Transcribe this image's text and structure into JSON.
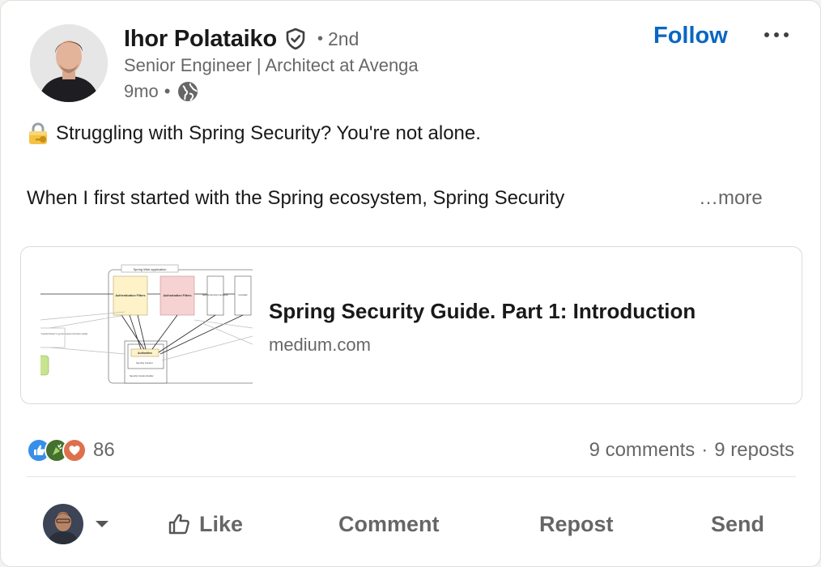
{
  "post": {
    "author": {
      "name": "Ihor Polataiko",
      "degree": "2nd",
      "degree_separator": "•",
      "headline": "Senior Engineer | Architect at Avenga",
      "time": "9mo",
      "time_separator": "•",
      "follow_label": "Follow",
      "more_label": "•••"
    },
    "text": {
      "line1": "Struggling with Spring Security? You're not alone.",
      "line2": "When I first started with the Spring ecosystem, Spring Security",
      "see_more": "…more"
    },
    "article": {
      "title": "Spring Security Guide. Part 1: Introduction",
      "source": "medium.com",
      "thumbnail_text": {
        "app_box": "Spring Web application",
        "auth_filters": "Authentication Filters",
        "authz_filters": "Authorization Filters",
        "method_security": "Method Security Interceptor",
        "controller": "Controller",
        "authorities": "Authorities",
        "security_context": "Security Context",
        "context_holder": "Security Context Holder",
        "note": "\"unauthenticated\" to get the request information details"
      }
    },
    "social": {
      "reactions_count": "86",
      "comments": "9 comments",
      "separator": "·",
      "reposts": "9 reposts"
    },
    "actions": {
      "like": "Like",
      "comment": "Comment",
      "repost": "Repost",
      "send": "Send"
    }
  },
  "colors": {
    "brand_blue": "#0a66c2",
    "like_blue": "#378fe9",
    "celebrate_green": "#44712e",
    "love_red": "#df704d",
    "muted_text": "#666666"
  },
  "icons": [
    "verified-shield-icon",
    "globe-icon",
    "locked-with-key-emoji",
    "more-horizontal-icon",
    "like-reaction-icon",
    "celebrate-reaction-icon",
    "love-reaction-icon",
    "thumbs-up-icon",
    "caret-down-icon"
  ]
}
